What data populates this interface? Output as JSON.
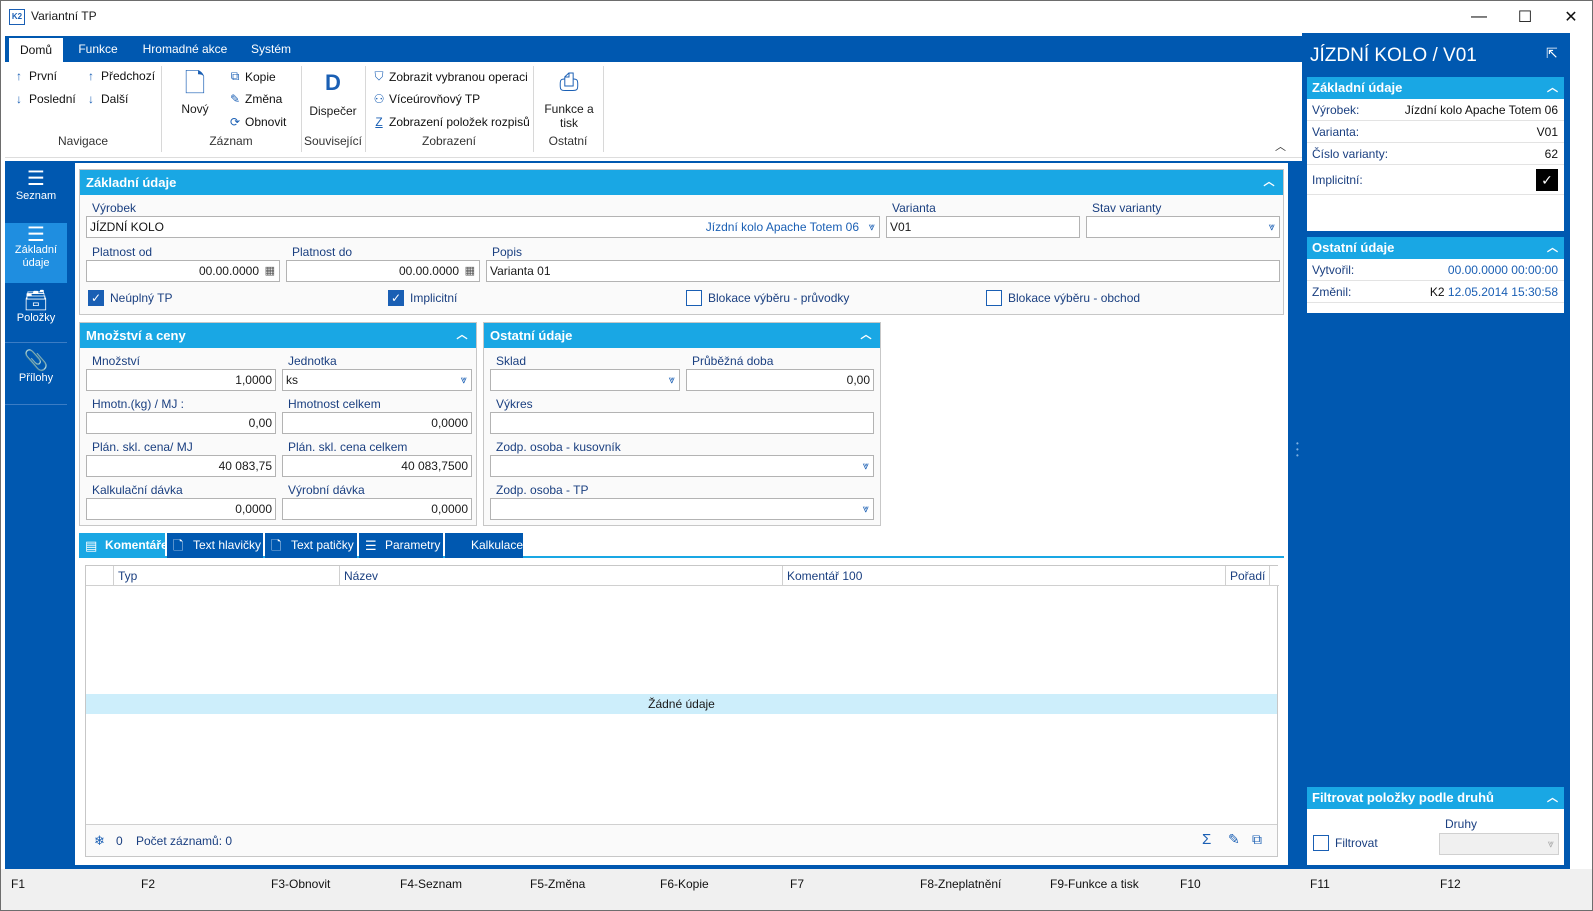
{
  "window": {
    "title": "Variantní TP",
    "minimize": "—",
    "maximize": "☐",
    "close": "✕"
  },
  "ribbon": {
    "tabs": [
      "Domů",
      "Funkce",
      "Hromadné akce",
      "Systém"
    ],
    "navigace": {
      "prvni": "První",
      "predchozi": "Předchozí",
      "posledni": "Poslední",
      "dalsi": "Další",
      "group": "Navigace"
    },
    "zaznam": {
      "novy": "Nový",
      "kopie": "Kopie",
      "zmena": "Změna",
      "obnovit": "Obnovit",
      "group": "Záznam"
    },
    "souvisejici": {
      "dispecer": "Dispečer",
      "group": "Související"
    },
    "zobrazeni": {
      "op": "Zobrazit vybranou operaci",
      "multi": "Víceúrovňový TP",
      "polozky": "Zobrazení položek rozpisů",
      "group": "Zobrazení"
    },
    "ostatni": {
      "funkce_line1": "Funkce a",
      "funkce_line2": "tisk",
      "group": "Ostatní"
    }
  },
  "leftnav": {
    "seznam": "Seznam",
    "zakladni_line1": "Základní",
    "zakladni_line2": "údaje",
    "polozky": "Položky",
    "prilohy": "Přílohy"
  },
  "zakladni": {
    "title": "Základní údaje",
    "vyrobek_label": "Výrobek",
    "vyrobek_code": "JÍZDNÍ KOLO",
    "vyrobek_name": "Jízdní kolo Apache Totem 06",
    "varianta_label": "Varianta",
    "varianta_value": "V01",
    "stav_label": "Stav varianty",
    "stav_value": "",
    "platnost_od_label": "Platnost od",
    "platnost_od_value": "00.00.0000",
    "platnost_do_label": "Platnost do",
    "platnost_do_value": "00.00.0000",
    "popis_label": "Popis",
    "popis_value": "Varianta 01",
    "neuplny_label": "Neúplný TP",
    "neuplny_checked": true,
    "implicitni_label": "Implicitní",
    "implicitni_checked": true,
    "blok_pruvodky_label": "Blokace výběru - průvodky",
    "blok_obchod_label": "Blokace výběru - obchod"
  },
  "mnozstvi": {
    "title": "Množství a ceny",
    "mnozstvi_label": "Množství",
    "mnozstvi_value": "1,0000",
    "jednotka_label": "Jednotka",
    "jednotka_value": "ks",
    "hmotn_label": "Hmotn.(kg) / MJ :",
    "hmotn_value": "0,00",
    "hmotn_celkem_label": "Hmotnost celkem",
    "hmotn_celkem_value": "0,0000",
    "plan_cena_label": "Plán. skl. cena/ MJ",
    "plan_cena_value": "40 083,75",
    "plan_cena_celkem_label": "Plán. skl. cena celkem",
    "plan_cena_celkem_value": "40 083,7500",
    "kalk_davka_label": "Kalkulační dávka",
    "kalk_davka_value": "0,0000",
    "vyr_davka_label": "Výrobní dávka",
    "vyr_davka_value": "0,0000"
  },
  "ostatni": {
    "title": "Ostatní údaje",
    "sklad_label": "Sklad",
    "sklad_value": "",
    "prubezna_label": "Průběžná doba",
    "prubezna_value": "0,00",
    "vykres_label": "Výkres",
    "vykres_value": "",
    "zodp_kus_label": "Zodp. osoba - kusovník",
    "zodp_kus_value": "",
    "zodp_tp_label": "Zodp. osoba - TP",
    "zodp_tp_value": ""
  },
  "bottomtabs": [
    "Komentáře",
    "Text hlavičky",
    "Text patičky",
    "Parametry",
    "Kalkulace"
  ],
  "grid": {
    "columns": [
      "Typ",
      "Název",
      "Komentář 100",
      "Pořadí"
    ],
    "empty": "Žádné údaje",
    "footer_count": "0",
    "footer_records": "Počet záznamů: 0"
  },
  "rightpane": {
    "title": "JÍZDNÍ KOLO / V01",
    "zakladni_title": "Základní údaje",
    "rows": [
      {
        "k": "Výrobek:",
        "v": "Jízdní kolo Apache Totem 06"
      },
      {
        "k": "Varianta:",
        "v": "V01"
      },
      {
        "k": "Číslo varianty:",
        "v": "62"
      }
    ],
    "implicitni_label": "Implicitní:",
    "ostatni_title": "Ostatní údaje",
    "vytvoril_label": "Vytvořil:",
    "vytvoril_value": "00.00.0000 00:00:00",
    "zmenil_label": "Změnil:",
    "zmenil_user": "K2",
    "zmenil_value": "12.05.2014 15:30:58",
    "filtr_title": "Filtrovat položky podle druhů",
    "filtrovat_label": "Filtrovat",
    "druhy_label": "Druhy"
  },
  "statusbar": [
    "F1",
    "F2",
    "F3-Obnovit",
    "F4-Seznam",
    "F5-Změna",
    "F6-Kopie",
    "F7",
    "F8-Zneplatnění",
    "F9-Funkce a tisk",
    "F10",
    "F11",
    "F12"
  ],
  "colors": {
    "primary": "#0058b0",
    "accent": "#19a7e4"
  }
}
